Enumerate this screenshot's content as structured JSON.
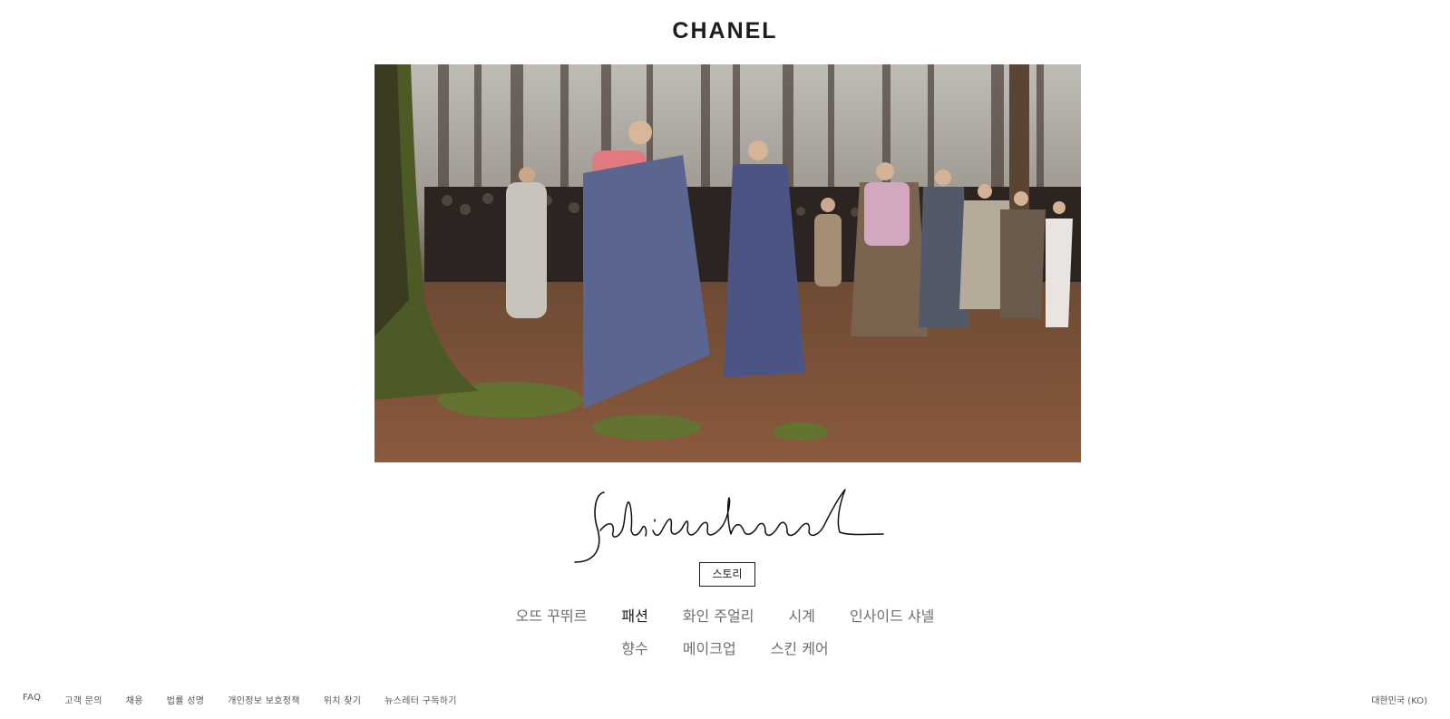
{
  "header": {
    "logo": "CHANEL"
  },
  "hero": {
    "image_icon": "runway-forest-photo"
  },
  "signature": {
    "icon": "gabrielle-chanel-signature-icon"
  },
  "story_button": {
    "label": "스토리"
  },
  "categories": {
    "row1": [
      {
        "label": "오뜨 꾸뛰르",
        "active": false
      },
      {
        "label": "패션",
        "active": true
      },
      {
        "label": "화인 주얼리",
        "active": false
      },
      {
        "label": "시계",
        "active": false
      },
      {
        "label": "인사이드 샤넬",
        "active": false
      }
    ],
    "row2": [
      {
        "label": "향수",
        "active": false
      },
      {
        "label": "메이크업",
        "active": false
      },
      {
        "label": "스킨 케어",
        "active": false
      }
    ]
  },
  "footer": {
    "links": [
      "FAQ",
      "고객 문의",
      "채용",
      "법률 성명",
      "개인정보 보호정책",
      "위치 찾기",
      "뉴스레터 구독하기"
    ],
    "locale": "대한민국 (KO)"
  },
  "colors": {
    "text_dark": "#1d1d1b",
    "text_muted": "#6f6f6f",
    "background": "#ffffff"
  }
}
